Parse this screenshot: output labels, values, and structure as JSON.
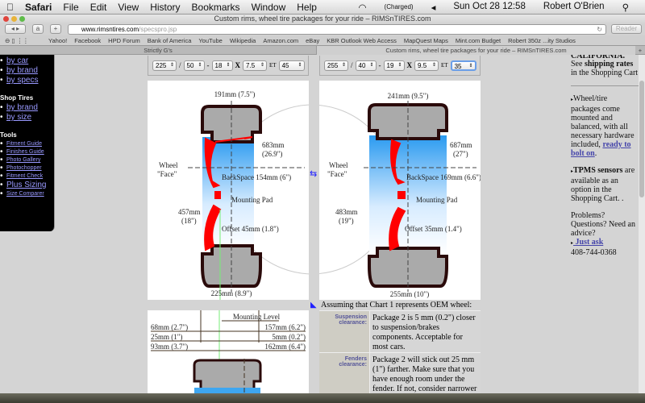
{
  "menubar": {
    "app": "Safari",
    "items": [
      "File",
      "Edit",
      "View",
      "History",
      "Bookmarks",
      "Window",
      "Help"
    ],
    "battery": "(Charged)",
    "datetime": "Sun Oct 28  12:58",
    "user": "Robert O'Brien"
  },
  "window": {
    "title": "Custom rims, wheel tire packages for your ride – RIMSnTIRES.com"
  },
  "toolbar": {
    "url_host": "www.rimsntires.com",
    "url_path": "/specspro.jsp",
    "reader": "Reader"
  },
  "bookmarks": [
    "Yahoo!",
    "Facebook",
    "HPD Forum",
    "Bank of America",
    "YouTube",
    "Wikipedia",
    "Amazon.com",
    "eBay",
    "KBR Outlook Web Access",
    "MapQuest Maps",
    "Mint.com Budget",
    "Robert 350z ...ity Studios"
  ],
  "tabs": [
    {
      "label": "Strictly G's"
    },
    {
      "label": "Custom rims, wheel tire packages for your ride – RIMSnTIRES.com"
    }
  ],
  "sidebar": {
    "wheels": [
      "by car",
      "by brand",
      "by specs"
    ],
    "tires_heading": "Shop Tires",
    "tires": [
      "by brand",
      "by size"
    ],
    "tools_heading": "Tools",
    "tools": [
      "Fitment Guide",
      "Finishes Guide",
      "Photo Gallery",
      "Photochopper",
      "Fitment Check",
      "Plus Sizing",
      "Size Comparer"
    ]
  },
  "specs": {
    "sep_slash": "/",
    "sep_dash": "-",
    "sep_x": "X",
    "et": "ET",
    "pkg1": {
      "width": "225",
      "aspect": "50",
      "rim": "18",
      "rim_width": "7.5",
      "offset": "45"
    },
    "pkg2": {
      "width": "255",
      "aspect": "40",
      "rim": "19",
      "rim_width": "9.5",
      "offset": "35"
    }
  },
  "chart1": {
    "rim_width": "191mm (7.5\")",
    "diameter_mm": "683mm",
    "diameter_in": "(26.9\")",
    "wheel_face": "Wheel",
    "wheel_face2": "\"Face\"",
    "backspace": "BackSpace 154mm (6\")",
    "mounting_pad": "Mounting Pad",
    "rim_dia_mm": "457mm",
    "rim_dia_in": "(18\")",
    "offset": "Offset 45mm (1.8\")",
    "tire_width": "225mm (8.9\")"
  },
  "chart2": {
    "rim_width": "241mm (9.5\")",
    "diameter_mm": "687mm",
    "diameter_in": "(27\")",
    "wheel_face": "Wheel",
    "wheel_face2": "\"Face\"",
    "backspace": "BackSpace 169mm (6.6\")",
    "mounting_pad": "Mounting Pad",
    "rim_dia_mm": "483mm",
    "rim_dia_in": "(19\")",
    "offset": "Offset 35mm (1.4\")",
    "tire_width": "255mm (10\")"
  },
  "comparison": {
    "mounting_level": "Mounting Level",
    "rows": [
      [
        "68mm (2.7\")",
        "157mm (6.2\")"
      ],
      [
        "25mm (1\")",
        "5mm (0.2\")"
      ],
      [
        "93mm (3.7\")",
        "162mm (6.4\")"
      ]
    ]
  },
  "assume": "Assuming that Chart 1 represents OEM wheel:",
  "clearance": [
    {
      "label": "Suspension clearance:",
      "text": "Package 2 is 5 mm (0.2\") closer to suspension/brakes components. Acceptable for most cars."
    },
    {
      "label": "Fenders clearance:",
      "text": "Package 2 will stick out 25 mm (1\") farther. Make sure that you have enough room under the fender. If not, consider narrower"
    }
  ],
  "right": {
    "cut": "CALIFORNIA.",
    "ship1": "See ",
    "ship_link": "shipping rates",
    "ship2": " in the Shopping Cart",
    "pkg1": "Wheel/tire packages come mounted and balanced, with all necessary hardware included, ",
    "pkg_link": "ready to bolt on",
    "pkg2": ".",
    "tpms_b": "TPMS sensors",
    "tpms": " are available as an option in the Shopping Cart. .",
    "problems": "Problems? Questions? Need an advice?",
    "ask": " Just ask",
    "phone": "408-744-0368"
  },
  "colors": {
    "tire": "#2a0a0a",
    "rim": "#ff0000",
    "barrel": "#3ea6f0",
    "background": "#d4d4d4"
  }
}
